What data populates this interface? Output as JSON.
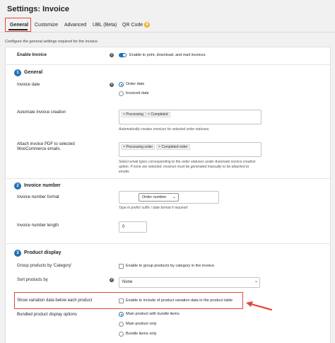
{
  "page": {
    "title": "Settings: Invoice",
    "description": "Configure the general settings required for the invoice."
  },
  "tabs": [
    {
      "label": "General",
      "active": true
    },
    {
      "label": "Customize"
    },
    {
      "label": "Advanced"
    },
    {
      "label": "UBL (Beta)"
    },
    {
      "label": "QR Code"
    }
  ],
  "enable_invoice": {
    "label": "Enable Invoice",
    "toggle_text": "Enable to print, download, and mail invoices.",
    "enabled": true
  },
  "general": {
    "number": "1",
    "title": "General",
    "invoice_date": {
      "label": "Invoice date",
      "options": [
        "Order date",
        "Invoiced date"
      ],
      "selected": "Order date"
    },
    "automate": {
      "label": "Automate invoice creation",
      "chips": [
        "Processing",
        "Completed"
      ],
      "hint": "Automatically creates invoices for selected order statuses."
    },
    "attach": {
      "label_line1": "Attach invoice PDF to selected",
      "label_line2": "WooCommerce emails.",
      "chips": [
        "Processing order",
        "Completed order"
      ],
      "hint_line1": "Select email types corresponding to the order statuses under Automate invoice creation",
      "hint_line2": "option. If none are selected, invoices must be generated manually to be attached to",
      "hint_line3": "emails."
    }
  },
  "invoice_number": {
    "number": "2",
    "title": "Invoice number",
    "format": {
      "label": "Invoice number format",
      "selected": "Order number",
      "hint": "Type in prefix/ suffix / date format if required"
    },
    "length": {
      "label": "Invoice number length",
      "value": "0"
    }
  },
  "product_display": {
    "number": "3",
    "title": "Product display",
    "group": {
      "label": "Group products by 'Category'",
      "checkbox_text": "Enable to group products by category in the invoice"
    },
    "sort": {
      "label": "Sort products by",
      "value": "None"
    },
    "variation": {
      "label": "Show variation data below each product",
      "checkbox_text": "Enable to include of product variation data in the product table"
    },
    "bundled": {
      "label": "Bundled product display options",
      "options": [
        "Main product with bundle items",
        "Main product only",
        "Bundle items only"
      ],
      "selected": "Main product with bundle items"
    }
  },
  "colors": {
    "accent": "#2271b1",
    "highlight": "#e2463a",
    "qr_badge": "#f0b323"
  },
  "icons": [
    "help-icon",
    "chevron-down-icon",
    "arrow-icon"
  ]
}
